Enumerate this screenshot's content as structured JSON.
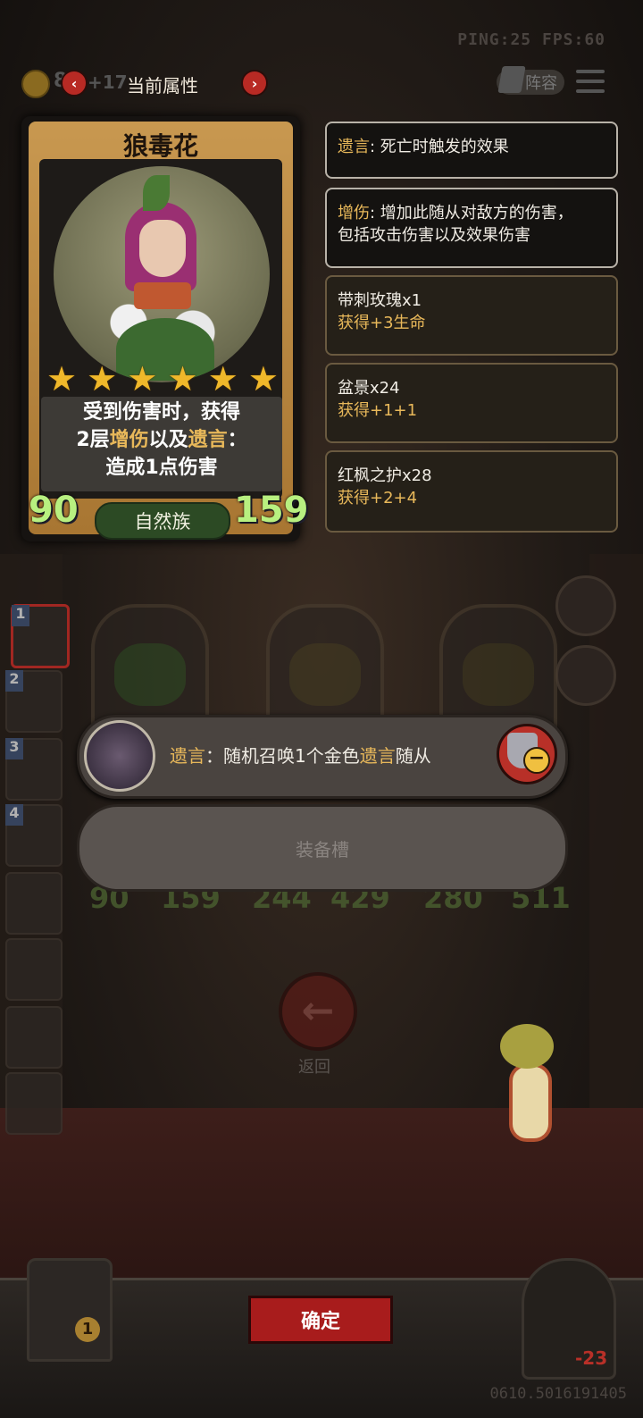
{
  "status": {
    "ping_fps": "PING:25  FPS:60"
  },
  "header": {
    "gold_amount": "8",
    "gold_income": "+17",
    "prev_label": "‹",
    "next_label": "›",
    "title": "当前属性",
    "lineup_label": "阵容"
  },
  "card": {
    "name": "狼毒花",
    "stars": [
      "★",
      "★",
      "★",
      "★",
      "★",
      "★"
    ],
    "desc_line1": "受到伤害时，获得",
    "desc_line2_a": "2层",
    "desc_line2_b": "增伤",
    "desc_line2_c": "以及",
    "desc_line2_d": "遗言",
    "desc_line2_e": "：",
    "desc_line3": "造成1点伤害",
    "attack": "90",
    "health": "159",
    "tribe": "自然族"
  },
  "panels": {
    "deathrattle_key": "遗言",
    "deathrattle_text": ": 死亡时触发的效果",
    "dmgup_key": "增伤",
    "dmgup_text": ": 增加此随从对敌方的伤害，",
    "dmgup_text2": "包括攻击伤害以及效果伤害",
    "items": [
      {
        "name": "带刺玫瑰x1",
        "effect": "获得+3生命"
      },
      {
        "name": "盆景x24",
        "effect": "获得+1+1"
      },
      {
        "name": "红枫之护x28",
        "effect": "获得+2+4"
      }
    ]
  },
  "sidebar": {
    "numbers": [
      "1",
      "2",
      "3",
      "4"
    ]
  },
  "board": {
    "stats": [
      {
        "atk": "90",
        "hp": "159"
      },
      {
        "atk": "244",
        "hp": "429"
      },
      {
        "atk": "280",
        "hp": "511"
      }
    ]
  },
  "equipment": {
    "key": "遗言",
    "text_a": "：随机召唤1个金色",
    "text_b": "遗言",
    "text_c": "随从",
    "slot_label": "装备槽"
  },
  "actions": {
    "back_label": "返回",
    "confirm_label": "确定",
    "chest_count": "1",
    "boss_hp": "-23"
  },
  "footer": {
    "id": "0610.5016191405"
  }
}
